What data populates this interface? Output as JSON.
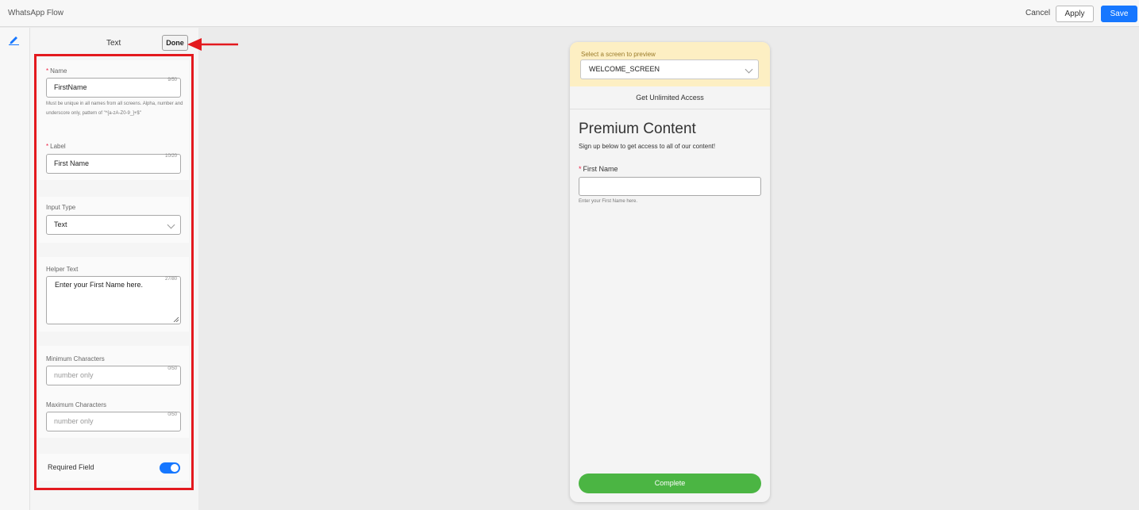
{
  "header": {
    "app_title": "WhatsApp Flow",
    "cancel_label": "Cancel",
    "apply_label": "Apply",
    "save_label": "Save"
  },
  "sidebar": {
    "icon": "pencil-icon"
  },
  "properties": {
    "title": "Text",
    "done_label": "Done",
    "name": {
      "label": "Name",
      "value": "FirstName",
      "counter": "9/50",
      "hint": "Must be unique in all names from all screens. Alpha, number and underscore only, pattern of \"^[a-zA-Z0-9_]+$\""
    },
    "label_field": {
      "label": "Label",
      "value": "First Name",
      "counter": "10/20"
    },
    "input_type": {
      "label": "Input Type",
      "value": "Text"
    },
    "helper_text": {
      "label": "Helper Text",
      "value": "Enter your First Name here.",
      "counter": "27/80"
    },
    "min_chars": {
      "label": "Minimum Characters",
      "placeholder": "number only",
      "counter": "0/50"
    },
    "max_chars": {
      "label": "Maximum Characters",
      "placeholder": "number only",
      "counter": "0/50"
    },
    "required": {
      "label": "Required Field",
      "enabled": true
    }
  },
  "preview": {
    "select_label": "Select a screen to preview",
    "screen_value": "WELCOME_SCREEN",
    "screen_header": "Get Unlimited Access",
    "title": "Premium Content",
    "subtitle": "Sign up below to get access to all of our content!",
    "field_label": "First Name",
    "helper": "Enter your First Name here.",
    "button_label": "Complete"
  },
  "colors": {
    "accent": "#1677ff",
    "highlight": "#e3191e",
    "preview_header": "#fdefc3",
    "complete_button": "#4bb543"
  }
}
